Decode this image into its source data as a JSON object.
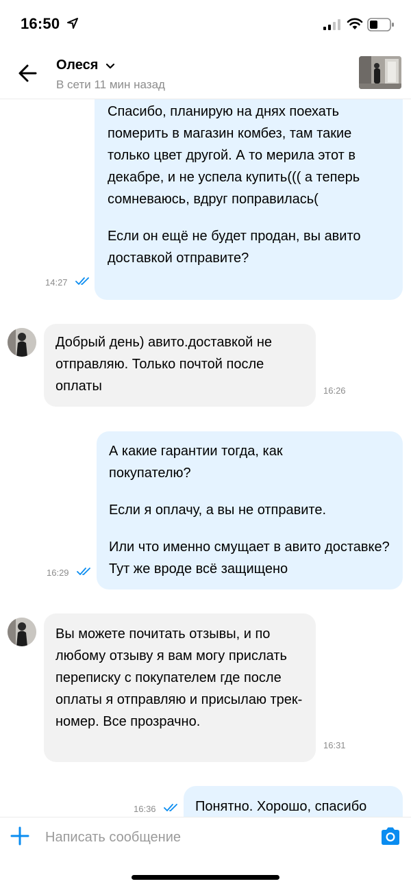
{
  "status_bar": {
    "time": "16:50"
  },
  "header": {
    "contact_name": "Олеся",
    "contact_status": "В сети 11 мин назад"
  },
  "messages": [
    {
      "direction": "outgoing",
      "paragraphs": [
        "Спасибо, планирую на днях поехать померить в магазин комбез, там такие только цвет другой. А то мерила этот в декабре, и не успела купить((( а теперь сомневаюсь, вдруг поправилась(",
        "Если он ещё не будет продан, вы авито доставкой отправите?"
      ],
      "time": "14:27",
      "read": true
    },
    {
      "direction": "incoming",
      "paragraphs": [
        "Добрый день) авито.доставкой не отправляю. Только почтой после оплаты"
      ],
      "time": "16:26"
    },
    {
      "direction": "outgoing",
      "paragraphs": [
        "А какие гарантии тогда, как покупателю?",
        "Если я оплачу, а вы не отправите.",
        "Или что именно смущает в авито доставке? Тут же вроде всё защищено"
      ],
      "time": "16:29",
      "read": true
    },
    {
      "direction": "incoming",
      "paragraphs": [
        "Вы можете почитать отзывы, и по любому отзыву я вам могу прислать переписку с покупателем где после оплаты я отправляю и присылаю трек-номер. Все прозрачно."
      ],
      "time": "16:31"
    },
    {
      "direction": "outgoing",
      "paragraphs": [
        "Понятно. Хорошо, спасибо"
      ],
      "time": "16:36",
      "read": true
    }
  ],
  "composer": {
    "placeholder": "Написать сообщение"
  },
  "colors": {
    "accent": "#0a8cf0",
    "outgoing_bubble": "#e5f3ff",
    "incoming_bubble": "#f2f2f2",
    "muted_text": "#8c8c8c"
  },
  "icons": {
    "back": "arrow-left-icon",
    "location": "location-arrow-icon",
    "add": "plus-icon",
    "camera": "camera-icon",
    "read_receipt": "double-check-icon"
  }
}
